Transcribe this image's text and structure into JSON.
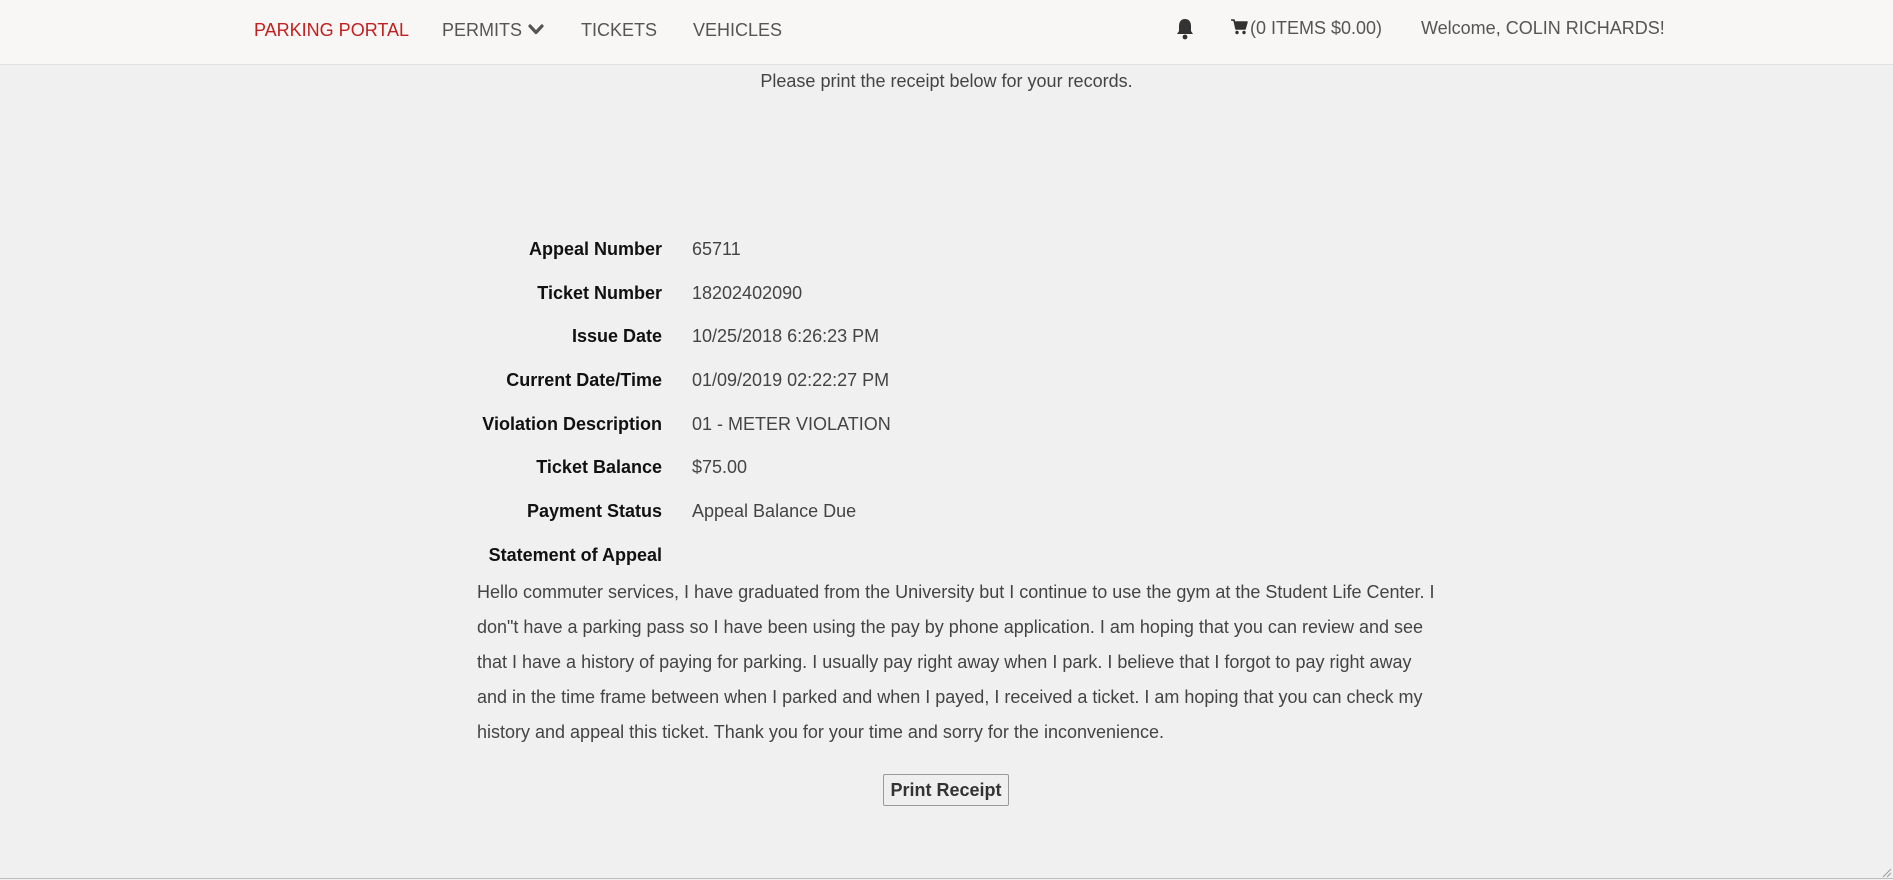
{
  "nav": {
    "brand": "PARKING PORTAL",
    "permits": "PERMITS",
    "tickets": "TICKETS",
    "vehicles": "VEHICLES",
    "cart": "(0 ITEMS $0.00)",
    "welcome": "Welcome, COLIN RICHARDS!"
  },
  "icons": {
    "permits_dropdown": "chevron-down-icon",
    "notifications": "bell-icon",
    "cart": "shopping-cart-icon"
  },
  "colors": {
    "brand": "#c0201f",
    "navbar_bg": "#f9f7f5",
    "page_bg": "#f0f0f0"
  },
  "instructions": "Please print the receipt below for your records.",
  "receipt": {
    "fields": [
      {
        "label": "Appeal Number",
        "value": "65711"
      },
      {
        "label": "Ticket Number",
        "value": "18202402090"
      },
      {
        "label": "Issue Date",
        "value": "10/25/2018 6:26:23 PM"
      },
      {
        "label": "Current Date/Time",
        "value": "01/09/2019 02:22:27 PM"
      },
      {
        "label": "Violation Description",
        "value": "01 - METER VIOLATION"
      },
      {
        "label": "Ticket Balance",
        "value": "$75.00"
      },
      {
        "label": "Payment Status",
        "value": "Appeal Balance Due"
      }
    ],
    "statement_label": "Statement of Appeal",
    "statement_text": "Hello commuter services, I have graduated from the University but I continue to use the gym at the Student Life Center. I don\"t have a parking pass so I have been using the pay by phone application. I am hoping that you can review and see that I have a history of paying for parking. I usually pay right away when I park. I believe that I forgot to pay right away and in the time frame between when I parked and when I payed, I received a ticket. I am hoping that you can check my history and appeal this ticket. Thank you for your time and sorry for the inconvenience."
  },
  "print_button": "Print Receipt"
}
